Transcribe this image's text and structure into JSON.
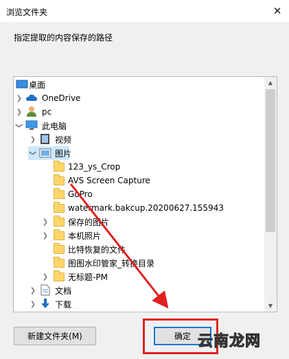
{
  "window": {
    "title": "浏览文件夹",
    "close_glyph": "✕",
    "prompt": "指定提取的内容保存的路径"
  },
  "tree": {
    "items": [
      {
        "label": "桌面",
        "icon": "desktop-icon",
        "expanded": true,
        "selected": false
      },
      {
        "label": "OneDrive",
        "icon": "cloud-icon",
        "expanded": false,
        "selected": false
      },
      {
        "label": "pc",
        "icon": "user-icon",
        "expanded": false,
        "selected": false
      },
      {
        "label": "此电脑",
        "icon": "computer-icon",
        "expanded": true,
        "selected": false
      },
      {
        "label": "视频",
        "icon": "video-folder-icon",
        "expanded": false,
        "selected": false
      },
      {
        "label": "图片",
        "icon": "pictures-folder-icon",
        "expanded": true,
        "selected": true
      },
      {
        "label": "123_ys_Crop",
        "icon": "folder-icon",
        "expanded": false,
        "selected": false
      },
      {
        "label": "AVS Screen Capture",
        "icon": "folder-icon",
        "expanded": false,
        "selected": false
      },
      {
        "label": "GoPro",
        "icon": "folder-icon",
        "expanded": false,
        "selected": false
      },
      {
        "label": "watermark.bakcup.20200627.155943",
        "icon": "folder-icon",
        "expanded": false,
        "selected": false
      },
      {
        "label": "保存的图片",
        "icon": "folder-icon",
        "expanded": false,
        "selected": false
      },
      {
        "label": "本机照片",
        "icon": "folder-icon",
        "expanded": false,
        "selected": false
      },
      {
        "label": "比特恢复的文件",
        "icon": "folder-icon",
        "expanded": false,
        "selected": false
      },
      {
        "label": "图图水印管家_转换目录",
        "icon": "folder-icon",
        "expanded": false,
        "selected": false
      },
      {
        "label": "无标题-PM",
        "icon": "folder-icon",
        "expanded": false,
        "selected": false
      },
      {
        "label": "文档",
        "icon": "documents-icon",
        "expanded": false,
        "selected": false
      },
      {
        "label": "下载",
        "icon": "download-icon",
        "expanded": false,
        "selected": false
      }
    ]
  },
  "buttons": {
    "new_folder": "新建文件夹(M)",
    "ok": "确定"
  },
  "watermark": "云南龙网",
  "colors": {
    "selection": "#cce8ff",
    "highlight_box": "#e02020",
    "default_button_border": "#0078d7"
  }
}
